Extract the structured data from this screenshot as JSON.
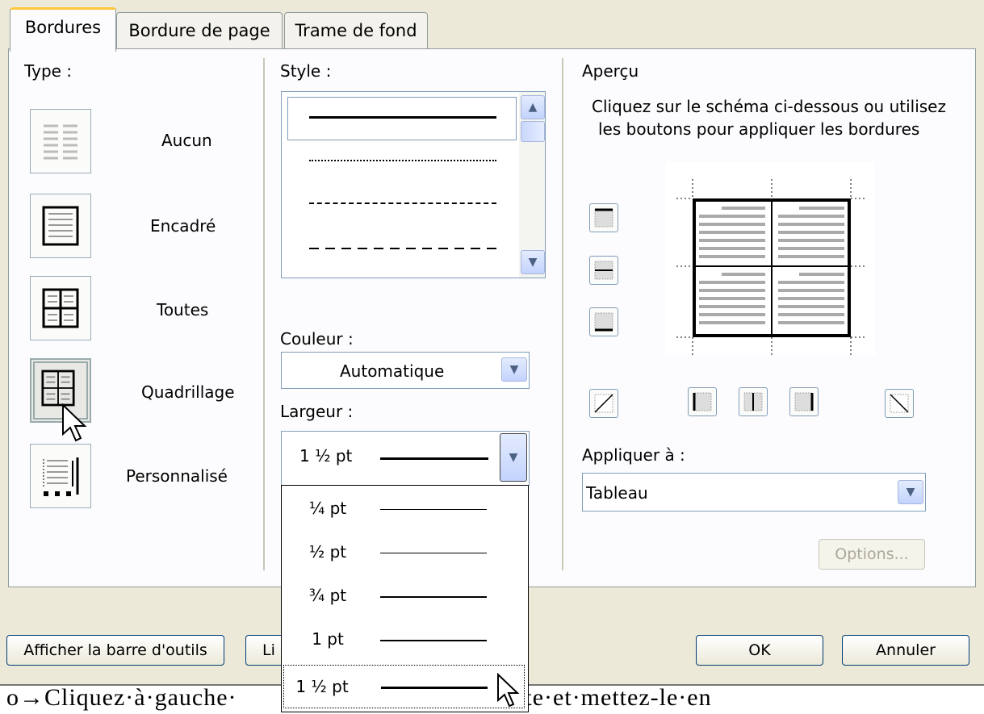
{
  "tabs": [
    {
      "label": "Bordures"
    },
    {
      "label": "Bordure de page"
    },
    {
      "label": "Trame de fond"
    }
  ],
  "type": {
    "label": "Type :",
    "options": [
      "Aucun",
      "Encadré",
      "Toutes",
      "Quadrillage",
      "Personnalisé"
    ]
  },
  "style": {
    "label": "Style :"
  },
  "couleur": {
    "label": "Couleur :",
    "value": "Automatique"
  },
  "largeur": {
    "label": "Largeur :",
    "value": "1 ½ pt",
    "options": [
      "¼ pt",
      "½ pt",
      "¾ pt",
      "1 pt",
      "1 ½ pt"
    ]
  },
  "apercu": {
    "label": "Aperçu",
    "hint_line1": "Cliquez sur le schéma ci-dessous ou utilisez",
    "hint_line2": "les boutons pour appliquer les bordures"
  },
  "appliquer": {
    "label": "Appliquer à :",
    "value": "Tableau"
  },
  "buttons": {
    "options": "Options...",
    "afficher": "Afficher la barre d'outils",
    "ligne_partial": "Li",
    "ok": "OK",
    "annuler": "Annuler"
  },
  "background_text": "o→Cliquez·à·gauche·           ,·puis·centrez·le·texte·et·mettez-le·en"
}
